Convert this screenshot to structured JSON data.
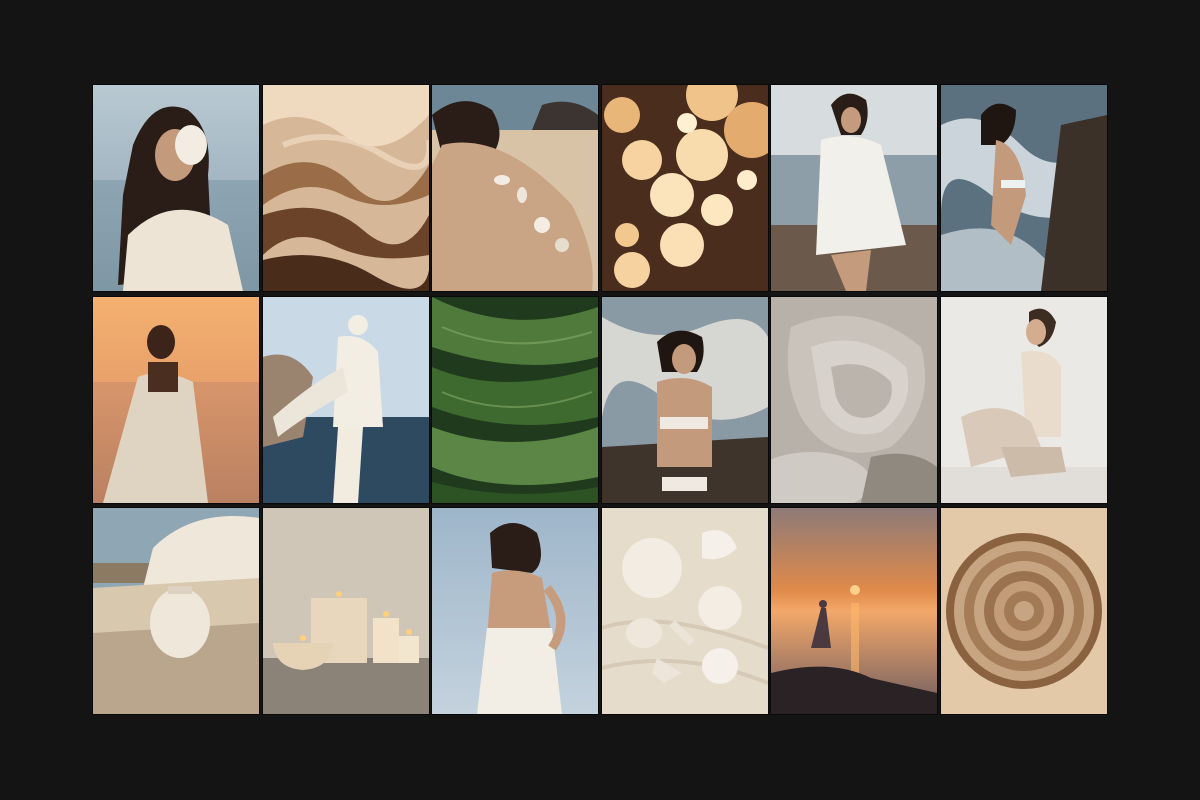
{
  "background_color": "#141414",
  "gallery": {
    "layout": "3x6 photo grid",
    "tiles": [
      {
        "subject": "woman-holding-seashell",
        "palette": [
          "#9fb3bf",
          "#ede4d6",
          "#2a1d17"
        ]
      },
      {
        "subject": "wavy-sand-dune-texture",
        "palette": [
          "#d6b898",
          "#5a3a24",
          "#f0dcc4"
        ]
      },
      {
        "subject": "woman-back-with-shells-on-beach",
        "palette": [
          "#c9a585",
          "#6e8796",
          "#e6d5bd"
        ]
      },
      {
        "subject": "paper-lanterns",
        "palette": [
          "#4a2d1c",
          "#f3c98e",
          "#ffe9c4"
        ]
      },
      {
        "subject": "woman-in-striped-shirt-seaside",
        "palette": [
          "#c8cfd4",
          "#f2f0ea",
          "#6b5a4c"
        ]
      },
      {
        "subject": "woman-in-white-swimsuit-waves",
        "palette": [
          "#5c7180",
          "#eef1f2",
          "#3c3129"
        ]
      },
      {
        "subject": "woman-in-white-dress-sunset",
        "palette": [
          "#f0a867",
          "#dfd3c2",
          "#3c241a"
        ]
      },
      {
        "subject": "woman-in-white-suit-walking-coast",
        "palette": [
          "#a9c4da",
          "#f3eee4",
          "#2e4a60"
        ]
      },
      {
        "subject": "green-leaves-closeup",
        "palette": [
          "#1f3a1c",
          "#4f7a3c",
          "#86a866"
        ]
      },
      {
        "subject": "woman-on-rocks-with-waves",
        "palette": [
          "#8a9aa4",
          "#efe9e2",
          "#3e342c"
        ]
      },
      {
        "subject": "grey-stone-texture",
        "palette": [
          "#a8a29a",
          "#d7d2cb",
          "#7b746c"
        ]
      },
      {
        "subject": "woman-seated-against-white-wall",
        "palette": [
          "#ebe9e6",
          "#d9c9b8",
          "#3c2c22"
        ]
      },
      {
        "subject": "ceramic-vase-on-rocks",
        "palette": [
          "#d8c8ae",
          "#efe7da",
          "#8fa7b4"
        ]
      },
      {
        "subject": "candles-on-stone",
        "palette": [
          "#cfc6b8",
          "#f6e6c6",
          "#8c8378"
        ]
      },
      {
        "subject": "woman-in-white-dress-back",
        "palette": [
          "#a8bfd2",
          "#f2eee6",
          "#2a1c16"
        ]
      },
      {
        "subject": "seashells-on-sand",
        "palette": [
          "#e6dccc",
          "#f5f1ea",
          "#b8a994"
        ]
      },
      {
        "subject": "silhouette-at-sunset-sea",
        "palette": [
          "#e08a4a",
          "#4a3a40",
          "#ffd08a"
        ]
      },
      {
        "subject": "wood-ring-cross-section",
        "palette": [
          "#c8a582",
          "#8a6240",
          "#e3c9a8"
        ]
      }
    ]
  }
}
